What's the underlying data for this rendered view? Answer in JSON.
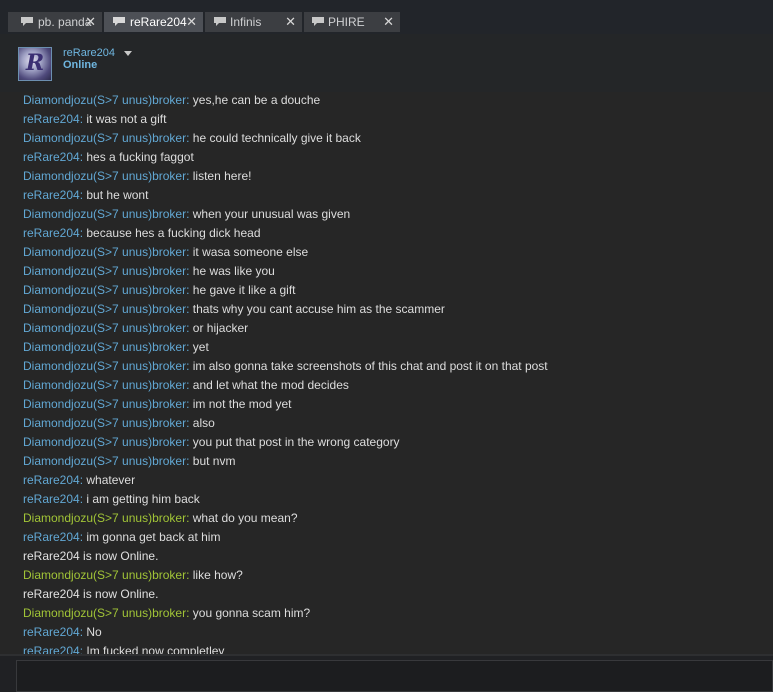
{
  "tabs": [
    {
      "label": "pb. panda",
      "close": "✕",
      "active": false
    },
    {
      "label": "reRare204",
      "close": "✕",
      "active": true
    },
    {
      "label": "Infinis",
      "close": "✕",
      "active": false
    },
    {
      "label": "PHIRE",
      "close": "✕",
      "active": false
    }
  ],
  "header": {
    "avatar_letter": "R",
    "name": "reRare204",
    "status": "Online"
  },
  "colors": {
    "name_blue": "#62a8d4",
    "name_green": "#a1c437",
    "message_text": "#dddddd",
    "background": "#262626"
  },
  "messages": [
    {
      "sender": "Diamondjozu(S>7 unus)broker",
      "text": "yes,he can be a douche",
      "color": "blue"
    },
    {
      "sender": "reRare204",
      "text": "it was not a gift",
      "color": "blue"
    },
    {
      "sender": "Diamondjozu(S>7 unus)broker",
      "text": "he could technically give it back",
      "color": "blue"
    },
    {
      "sender": "reRare204",
      "text": "hes a fucking faggot",
      "color": "blue"
    },
    {
      "sender": "Diamondjozu(S>7 unus)broker",
      "text": "listen here!",
      "color": "blue"
    },
    {
      "sender": "reRare204",
      "text": "but he wont",
      "color": "blue"
    },
    {
      "sender": "Diamondjozu(S>7 unus)broker",
      "text": "when your unusual was given",
      "color": "blue"
    },
    {
      "sender": "reRare204",
      "text": "because hes a fucking dick head",
      "color": "blue"
    },
    {
      "sender": "Diamondjozu(S>7 unus)broker",
      "text": "it wasa someone else",
      "color": "blue"
    },
    {
      "sender": "Diamondjozu(S>7 unus)broker",
      "text": "he was like you",
      "color": "blue"
    },
    {
      "sender": "Diamondjozu(S>7 unus)broker",
      "text": "he gave it like a gift",
      "color": "blue"
    },
    {
      "sender": "Diamondjozu(S>7 unus)broker",
      "text": "thats why you cant accuse him as the scammer",
      "color": "blue"
    },
    {
      "sender": "Diamondjozu(S>7 unus)broker",
      "text": "or hijacker",
      "color": "blue"
    },
    {
      "sender": "Diamondjozu(S>7 unus)broker",
      "text": "yet",
      "color": "blue"
    },
    {
      "sender": "Diamondjozu(S>7 unus)broker",
      "text": "im also gonna take screenshots of this chat and post it on that post",
      "color": "blue"
    },
    {
      "sender": "Diamondjozu(S>7 unus)broker",
      "text": "and let what the mod decides",
      "color": "blue"
    },
    {
      "sender": "Diamondjozu(S>7 unus)broker",
      "text": "im not the mod yet",
      "color": "blue"
    },
    {
      "sender": "Diamondjozu(S>7 unus)broker",
      "text": "also",
      "color": "blue"
    },
    {
      "sender": "Diamondjozu(S>7 unus)broker",
      "text": "you put that post in the wrong category",
      "color": "blue"
    },
    {
      "sender": "Diamondjozu(S>7 unus)broker",
      "text": "but nvm",
      "color": "blue"
    },
    {
      "sender": "reRare204",
      "text": "whatever",
      "color": "blue"
    },
    {
      "sender": "reRare204",
      "text": "i am getting him back",
      "color": "blue"
    },
    {
      "sender": "Diamondjozu(S>7 unus)broker",
      "text": "what do you mean?",
      "color": "green"
    },
    {
      "sender": "reRare204",
      "text": "im gonna get back at him",
      "color": "blue"
    },
    {
      "system": "reRare204 is now Online."
    },
    {
      "sender": "Diamondjozu(S>7 unus)broker",
      "text": "like how?",
      "color": "green"
    },
    {
      "system": "reRare204 is now Online."
    },
    {
      "sender": "Diamondjozu(S>7 unus)broker",
      "text": "you gonna scam him?",
      "color": "green"
    },
    {
      "sender": "reRare204",
      "text": "No",
      "color": "blue"
    },
    {
      "sender": "reRare204",
      "text": "Im fucked now completley",
      "color": "blue"
    }
  ]
}
